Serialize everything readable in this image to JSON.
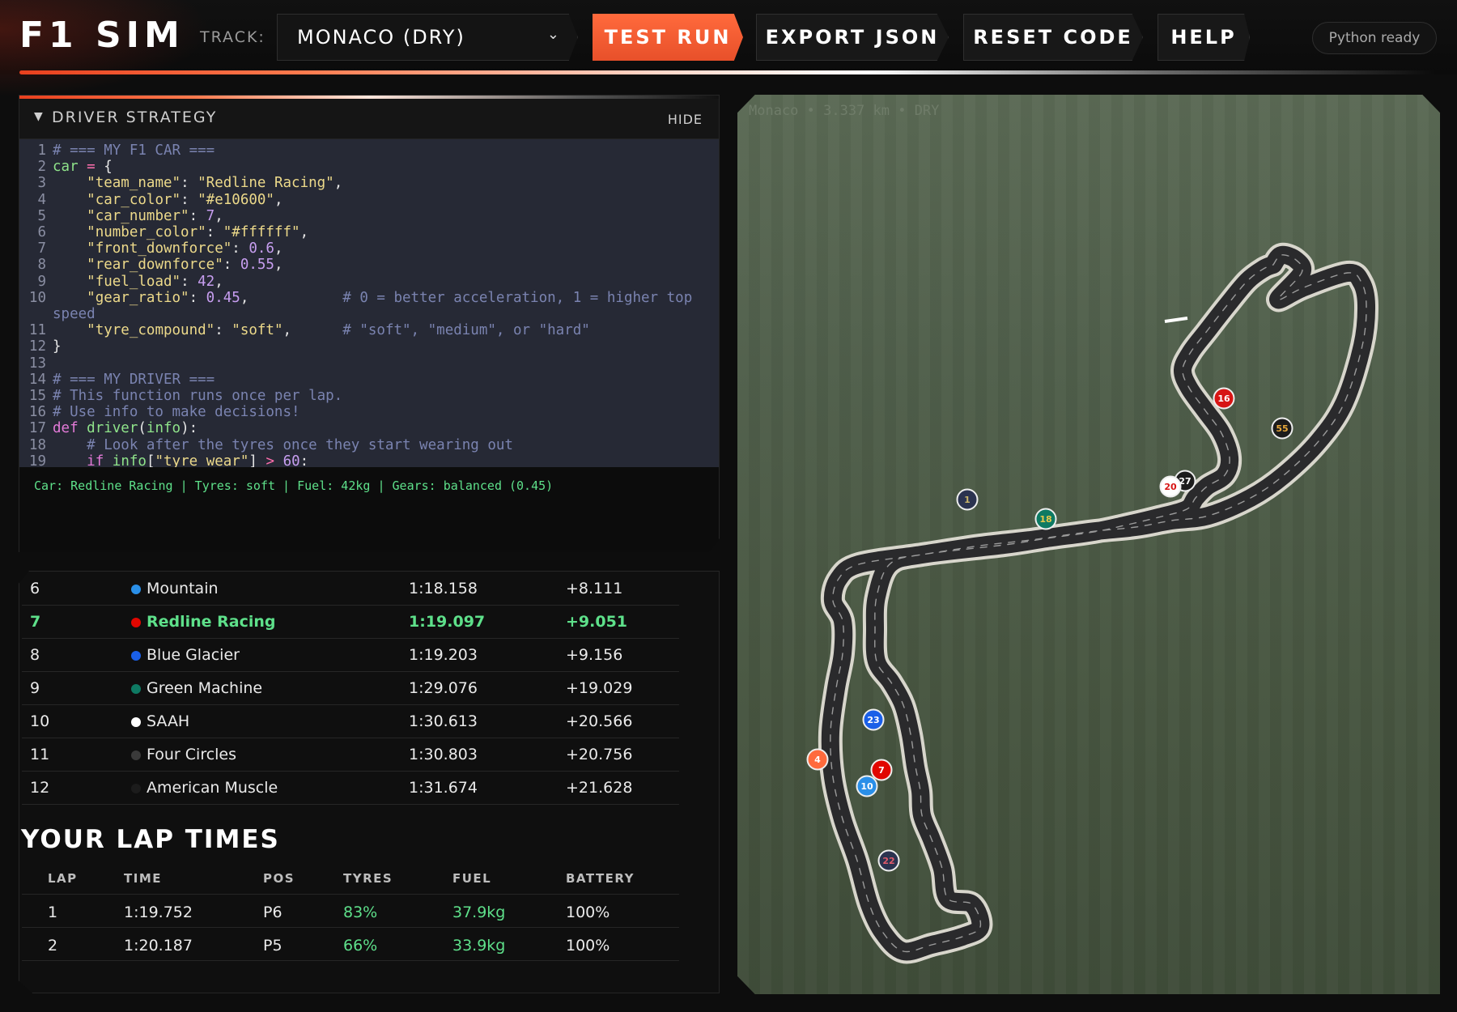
{
  "app": {
    "title": "F1 SIM",
    "track_label": "TRACK:",
    "track_selected": "MONACO (DRY)",
    "status": "Python ready"
  },
  "toolbar": {
    "test_run": "TEST RUN",
    "export_json": "EXPORT JSON",
    "reset_code": "RESET CODE",
    "help": "HELP"
  },
  "colors": {
    "accent": "#e8502a",
    "good": "#5ee08a",
    "editor_bg": "#262935"
  },
  "strategy": {
    "title": "DRIVER STRATEGY",
    "hide": "HIDE",
    "code_lines": [
      "# === MY F1 CAR ===",
      "car = {",
      "    \"team_name\": \"Redline Racing\",",
      "    \"car_color\": \"#e10600\",",
      "    \"car_number\": 7,",
      "    \"number_color\": \"#ffffff\",",
      "    \"front_downforce\": 0.6,",
      "    \"rear_downforce\": 0.55,",
      "    \"fuel_load\": 42,",
      "    \"gear_ratio\": 0.45,           # 0 = better acceleration, 1 = higher top speed",
      "    \"tyre_compound\": \"soft\",      # \"soft\", \"medium\", or \"hard\"",
      "}",
      "",
      "# === MY DRIVER ===",
      "# This function runs once per lap.",
      "# Use info to make decisions!",
      "def driver(info):",
      "    # Look after the tyres once they start wearing out",
      "    if info[\"tyre_wear\"] > 60:"
    ],
    "console": "Car: Redline Racing | Tyres: soft | Fuel: 42kg | Gears: balanced (0.45)"
  },
  "standings": [
    {
      "pos": "6",
      "team": "Mountain",
      "color": "#2a8fe8",
      "time": "1:18.158",
      "gap": "+8.111"
    },
    {
      "pos": "7",
      "team": "Redline Racing",
      "color": "#e10600",
      "time": "1:19.097",
      "gap": "+9.051",
      "me": true
    },
    {
      "pos": "8",
      "team": "Blue Glacier",
      "color": "#1a5fe8",
      "time": "1:19.203",
      "gap": "+9.156"
    },
    {
      "pos": "9",
      "team": "Green Machine",
      "color": "#0e7a63",
      "time": "1:29.076",
      "gap": "+19.029"
    },
    {
      "pos": "10",
      "team": "SAAH",
      "color": "#ffffff",
      "time": "1:30.613",
      "gap": "+20.566"
    },
    {
      "pos": "11",
      "team": "Four Circles",
      "color": "#3a3a3a",
      "time": "1:30.803",
      "gap": "+20.756"
    },
    {
      "pos": "12",
      "team": "American Muscle",
      "color": "#1c1c1c",
      "time": "1:31.674",
      "gap": "+21.628"
    }
  ],
  "laps": {
    "title": "YOUR LAP TIMES",
    "headers": [
      "LAP",
      "TIME",
      "POS",
      "TYRES",
      "FUEL",
      "BATTERY"
    ],
    "rows": [
      {
        "lap": "1",
        "time": "1:19.752",
        "pos": "P6",
        "tyres": "83%",
        "fuel": "37.9kg",
        "battery": "100%"
      },
      {
        "lap": "2",
        "time": "1:20.187",
        "pos": "P5",
        "tyres": "66%",
        "fuel": "33.9kg",
        "battery": "100%"
      }
    ]
  },
  "map": {
    "caption": "Monaco • 3.337 km • DRY",
    "cars": [
      {
        "num": "1",
        "fill": "#2b3350",
        "text": "#c9b56a"
      },
      {
        "num": "16",
        "fill": "#d71414",
        "text": "#ffffff"
      },
      {
        "num": "55",
        "fill": "#1c1c1c",
        "text": "#e8a83a"
      },
      {
        "num": "27",
        "fill": "#1c1c1c",
        "text": "#ffffff"
      },
      {
        "num": "20",
        "fill": "#ffffff",
        "text": "#d71414"
      },
      {
        "num": "18",
        "fill": "#0e7a63",
        "text": "#e8c84a"
      },
      {
        "num": "23",
        "fill": "#1a5fe8",
        "text": "#ffffff"
      },
      {
        "num": "4",
        "fill": "#ff6a3c",
        "text": "#ffffff"
      },
      {
        "num": "7",
        "fill": "#e10600",
        "text": "#ffffff"
      },
      {
        "num": "10",
        "fill": "#2a8fe8",
        "text": "#ffffff"
      },
      {
        "num": "22",
        "fill": "#2b3350",
        "text": "#e05a6a"
      }
    ]
  }
}
